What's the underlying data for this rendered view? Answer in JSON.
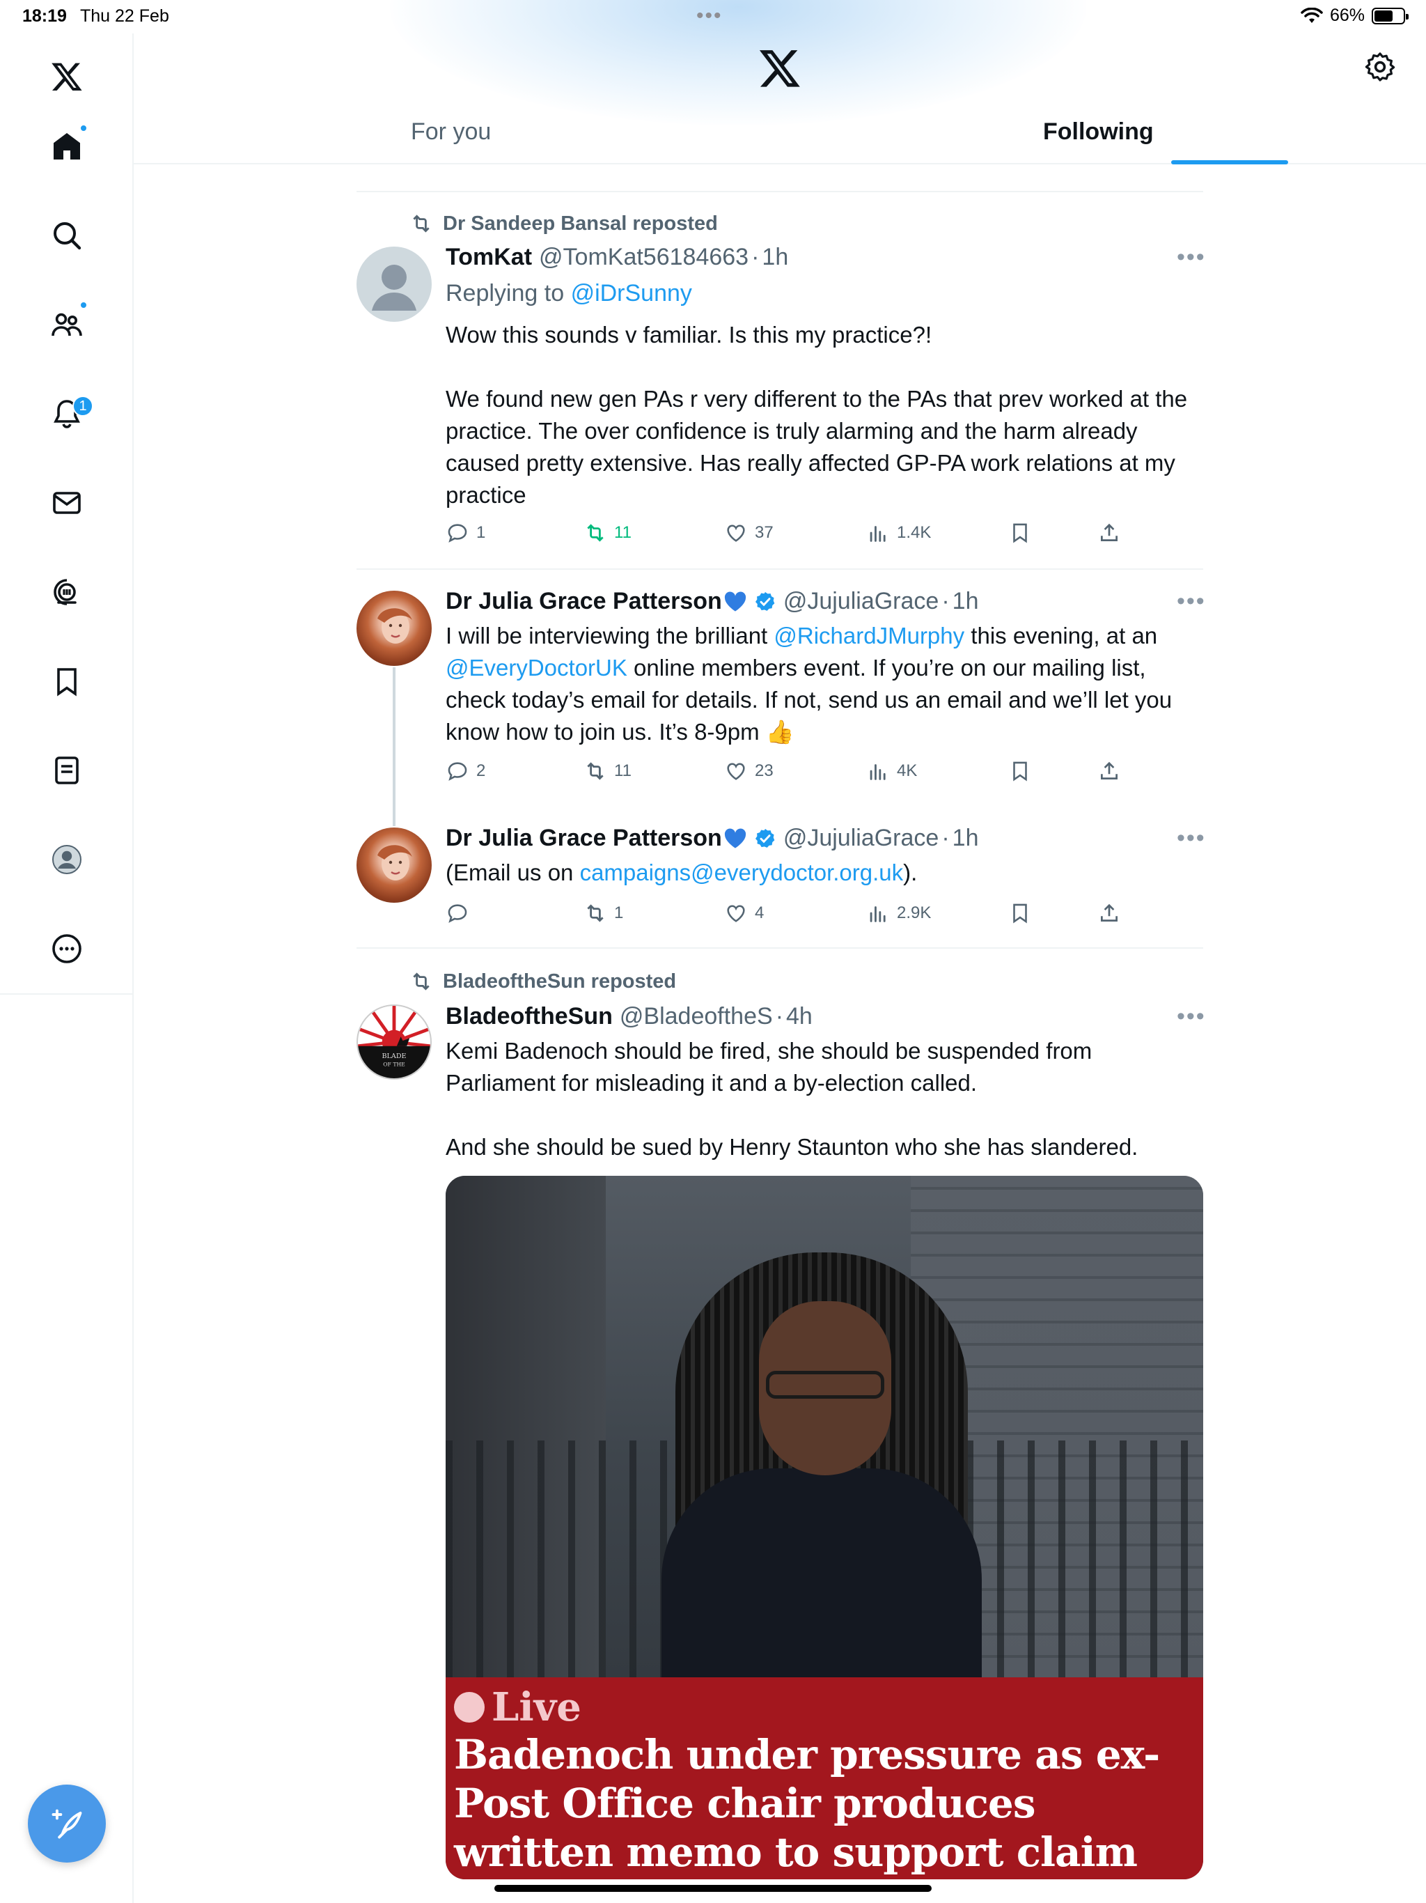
{
  "status_bar": {
    "time": "18:19",
    "date": "Thu 22 Feb",
    "battery": "66%",
    "battery_level": 0.66
  },
  "header": {
    "tabs": [
      "For you",
      "Following"
    ],
    "active_tab": "Following"
  },
  "sidebar": {
    "items": [
      {
        "icon": "x-logo-icon"
      },
      {
        "icon": "home-icon",
        "dot": true
      },
      {
        "icon": "search-icon"
      },
      {
        "icon": "communities-icon",
        "dot": true
      },
      {
        "icon": "notifications-icon",
        "badge": "1"
      },
      {
        "icon": "messages-icon"
      },
      {
        "icon": "grok-icon"
      },
      {
        "icon": "bookmarks-icon"
      },
      {
        "icon": "lists-icon"
      },
      {
        "icon": "profile-icon"
      },
      {
        "icon": "more-icon"
      }
    ],
    "compose_icon": "compose-icon"
  },
  "posts": [
    {
      "repost_by": "Dr Sandeep Bansal reposted",
      "name": "TomKat",
      "handle": "@TomKat56184663",
      "time": "1h",
      "replying_label": "Replying to",
      "replying_to": "@iDrSunny",
      "paragraphs": [
        "Wow this sounds v familiar.  Is this my practice?!",
        "We found new gen PAs r very different to the PAs that prev worked at the practice. The over confidence is truly alarming and the harm already caused pretty extensive. Has really affected GP-PA work relations at my practice"
      ],
      "stats": {
        "replies": "1",
        "reposts": "11",
        "likes": "37",
        "views": "1.4K"
      }
    },
    {
      "name": "Dr Julia Grace Patterson",
      "handle": "@JujuliaGrace",
      "time": "1h",
      "text_1": "I will be interviewing the brilliant ",
      "mention_1": "@RichardJMurphy",
      "text_2": " this evening, at an ",
      "mention_2": "@EveryDoctorUK",
      "text_3": " online members event. If you’re on our mailing list, check today’s email for details. If not, send us an email and we’ll let you know how to join us. It’s 8-9pm 👍",
      "stats": {
        "replies": "2",
        "reposts": "11",
        "likes": "23",
        "views": "4K"
      }
    },
    {
      "name": "Dr Julia Grace Patterson",
      "handle": "@JujuliaGrace",
      "time": "1h",
      "text_1": "(Email us on ",
      "email": "campaigns@everydoctor.org.uk",
      "text_2": ").",
      "stats": {
        "replies": "",
        "reposts": "1",
        "likes": "4",
        "views": "2.9K"
      }
    },
    {
      "repost_by": "BladeoftheSun reposted",
      "name": "BladeoftheSun",
      "handle": "@BladeoftheS",
      "time": "4h",
      "avatar_text": "BLADE OF THE",
      "paragraphs": [
        "Kemi Badenoch should be fired, she should be suspended from Parliament for misleading it and a by-election called.",
        "And she should be sued by Henry Staunton who she has slandered."
      ],
      "media": {
        "live_label": "Live",
        "headline": "Badenoch under pressure as ex-Post Office chair produces written memo to support claim minister dismissed as lie"
      }
    }
  ],
  "colors": {
    "accent": "#1d9bf0",
    "repost_green": "#00ba7c",
    "text": "#0f1419",
    "secondary": "#536471",
    "caption_red": "#a3171e"
  }
}
